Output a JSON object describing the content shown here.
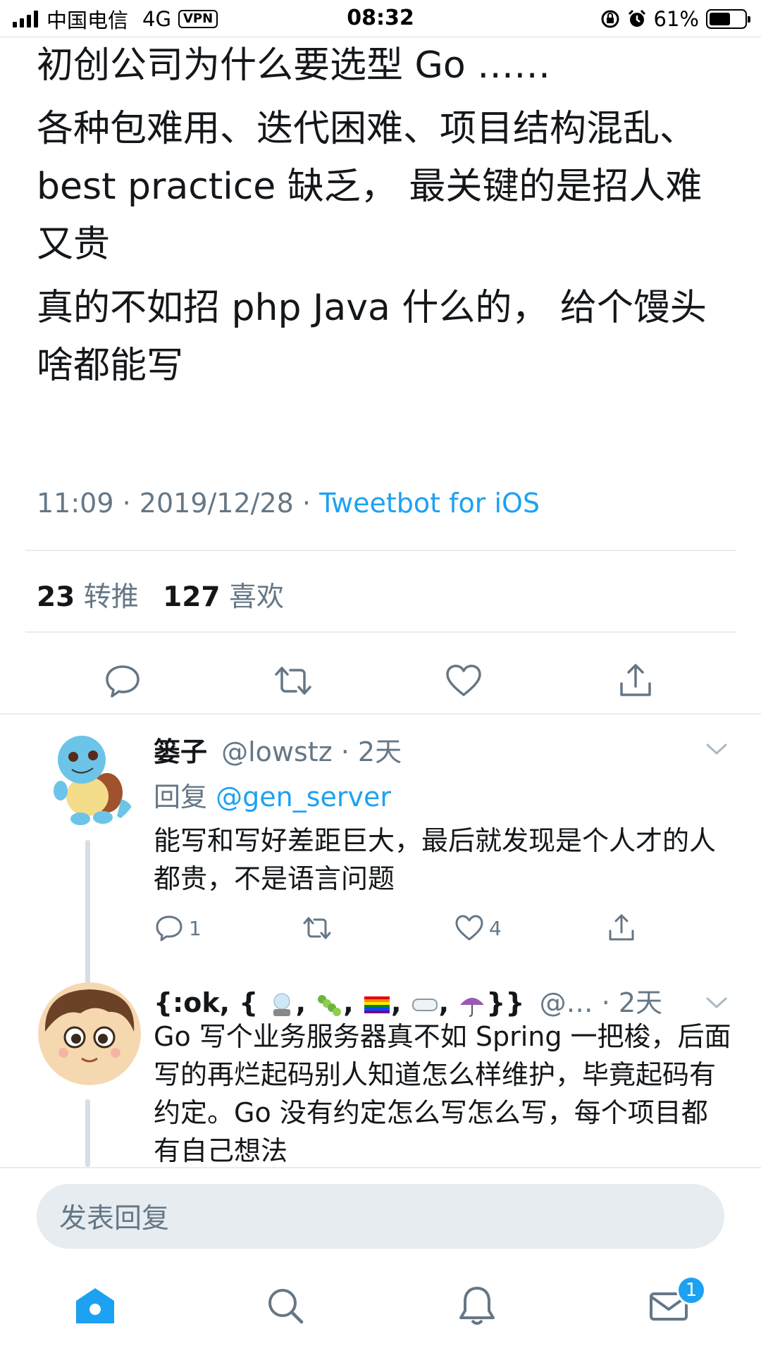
{
  "status_bar": {
    "carrier": "中国电信",
    "network": "4G",
    "vpn": "VPN",
    "time": "08:32",
    "battery": "61%",
    "battery_level": 0.61
  },
  "tweet": {
    "lines": [
      "初创公司为什么要选型 Go ……",
      "各种包难用、迭代困难、项目结构混乱、best practice 缺乏， 最关键的是招人难又贵",
      "真的不如招 php Java 什么的， 给个馒头啥都能写"
    ],
    "time": "11:09",
    "date": "2019/12/28",
    "sep": "·",
    "client": "Tweetbot for iOS",
    "retweets_count": "23",
    "retweets_label": "转推",
    "likes_count": "127",
    "likes_label": "喜欢"
  },
  "replies": [
    {
      "name": "篓子",
      "handle": "@lowstz",
      "time": "· 2天",
      "reply_prefix": "回复",
      "reply_to": "@gen_server",
      "text": "能写和写好差距巨大，最后就发现是个人才的人都贵，不是语言问题",
      "reply_count": "1",
      "like_count": "4"
    },
    {
      "name_start": "{:ok, {",
      "name_sep1": ",",
      "name_sep2": ",",
      "name_sep3": ",",
      "name_sep4": ",",
      "name_end": "}}",
      "handle": "@…",
      "time": "· 2天",
      "text": "Go 写个业务服务器真不如 Spring 一把梭，后面写的再烂起码别人知道怎么样维护，毕竟起码有约定。Go 没有约定怎么写怎么写，每个项目都有自己想法"
    }
  ],
  "reply_box": {
    "placeholder": "发表回复"
  },
  "tabbar": {
    "messages_badge": "1"
  },
  "colors": {
    "accent": "#1da1f2",
    "secondary_text": "#657786",
    "divider": "#e6ecf0"
  }
}
